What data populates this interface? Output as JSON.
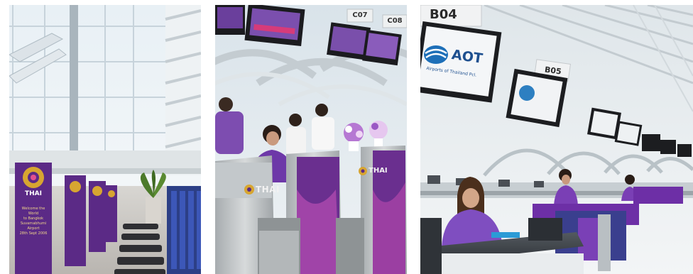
{
  "photos": [
    {
      "id": "departure-hall",
      "banner": {
        "logo_text": "THAI",
        "message_lines": [
          "Welcome the World",
          "to Bangkok",
          "Suvarnabhumi Airport",
          "28th Sept 2006"
        ]
      }
    },
    {
      "id": "thai-check-in",
      "counter_logo_text": "THAI",
      "counter_codes": [
        "C07",
        "C08"
      ]
    },
    {
      "id": "row-b-check-in",
      "counter_codes": [
        "B04",
        "B05"
      ],
      "screen_logo_text": "AOT",
      "screen_caption": "Airports of Thailand Pcl."
    }
  ],
  "colors": {
    "thai_purple": "#5b2a86",
    "thai_gold": "#d7a531",
    "sky": "#e9f1f6",
    "metal": "#c9cccd"
  }
}
